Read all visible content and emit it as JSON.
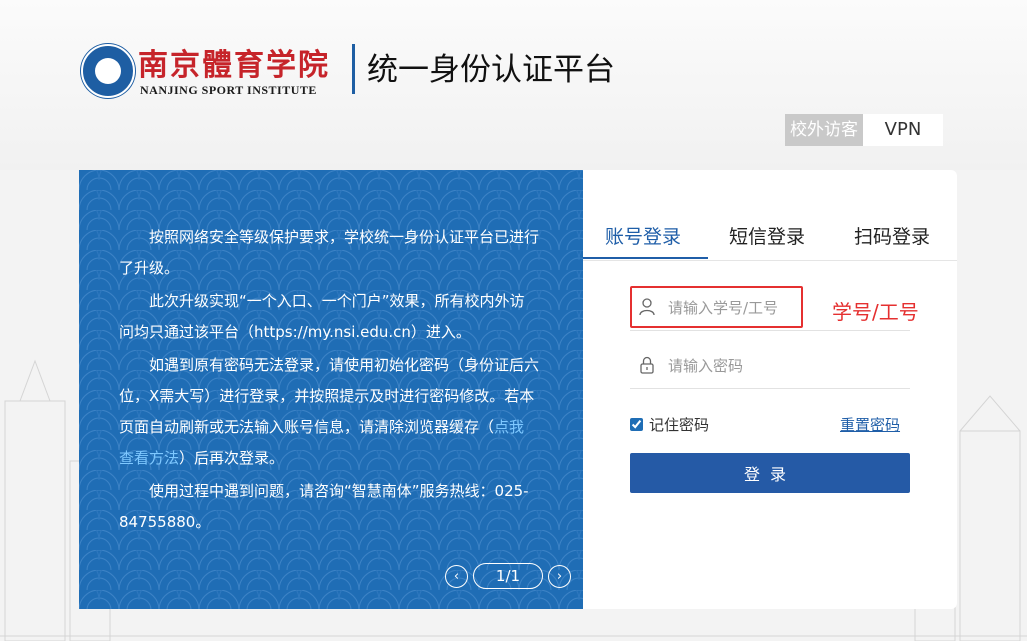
{
  "header": {
    "school_name_cn": "南京體育学院",
    "school_name_en": "NANJING SPORT INSTITUTE",
    "platform_title": "统一身份认证平台"
  },
  "nav": {
    "visitor": "校外访客",
    "vpn": "VPN"
  },
  "notice": {
    "p1": "按照网络安全等级保护要求，学校统一身份认证平台已进行了升级。",
    "p2": "此次升级实现“一个入口、一个门户”效果，所有校内外访问均只通过该平台（https://my.nsi.edu.cn）进入。",
    "p3": "如遇到原有密码无法登录，请使用初始化密码（身份证后六位，X需大写）进行登录，并按照提示及时进行密码修改。若本页面自动刷新或无法输入账号信息，请清除浏览器缓存（",
    "p3_link": "点我查看方法",
    "p3_end": "）后再次登录。",
    "p4": "使用过程中遇到问题，请咨询“智慧南体”服务热线：025-84755880。",
    "pager": "1/1",
    "prev": "‹",
    "next": "›"
  },
  "login": {
    "tabs": [
      "账号登录",
      "短信登录",
      "扫码登录"
    ],
    "username_placeholder": "请输入学号/工号",
    "password_placeholder": "请输入密码",
    "remember_label": "记住密码",
    "reset_label": "重置密码",
    "submit_label": "登录",
    "annotation": "学号/工号"
  },
  "colors": {
    "primary": "#1f5ea8",
    "panel": "#1f6db5",
    "annotation": "#e53030"
  },
  "icons": [
    "user-icon",
    "lock-icon"
  ]
}
